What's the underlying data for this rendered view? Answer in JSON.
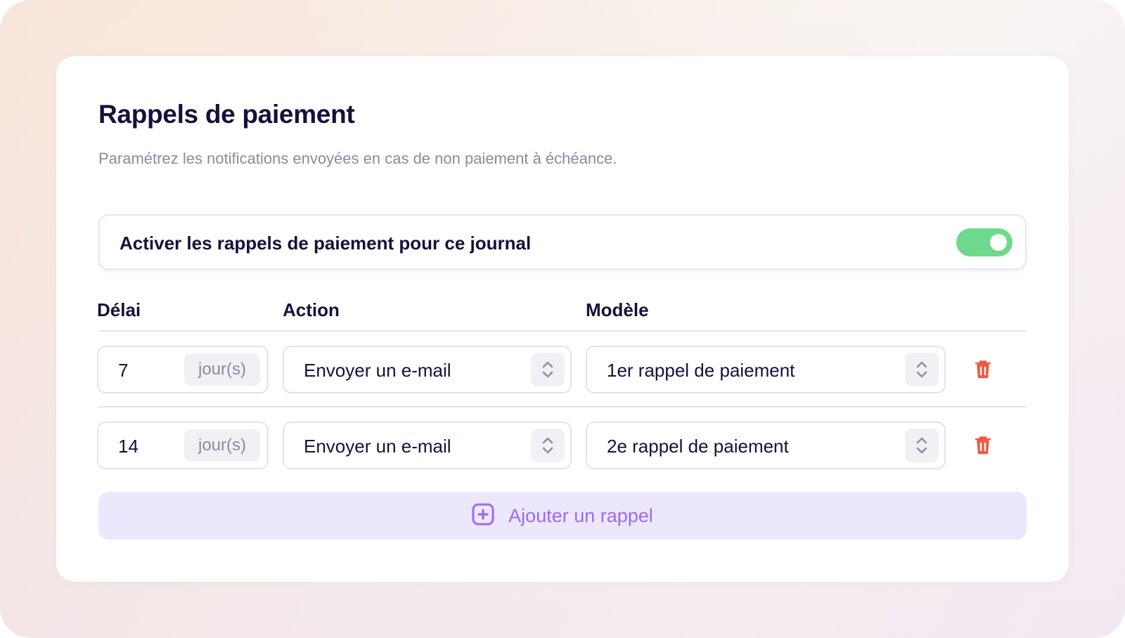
{
  "page": {
    "title": "Rappels de paiement",
    "subtitle": "Paramétrez les notifications envoyées en cas de non paiement à échéance."
  },
  "toggle": {
    "label": "Activer les rappels de paiement pour ce journal",
    "enabled": true,
    "color": "#6ed98c"
  },
  "columns": {
    "delay": "Délai",
    "action": "Action",
    "template": "Modèle"
  },
  "rows": [
    {
      "delay": "7",
      "unit": "jour(s)",
      "action": "Envoyer un e-mail",
      "template": "1er rappel de paiement",
      "delete_icon": "trash-icon"
    },
    {
      "delay": "14",
      "unit": "jour(s)",
      "action": "Envoyer un e-mail",
      "template": "2e rappel de paiement",
      "delete_icon": "trash-icon"
    }
  ],
  "add_button": {
    "label": "Ajouter un rappel",
    "icon": "plus-square-icon",
    "color": "#9a6cf0"
  },
  "colors": {
    "danger": "#ee5a43",
    "text": "#14123a",
    "muted": "#8b8aa0"
  }
}
